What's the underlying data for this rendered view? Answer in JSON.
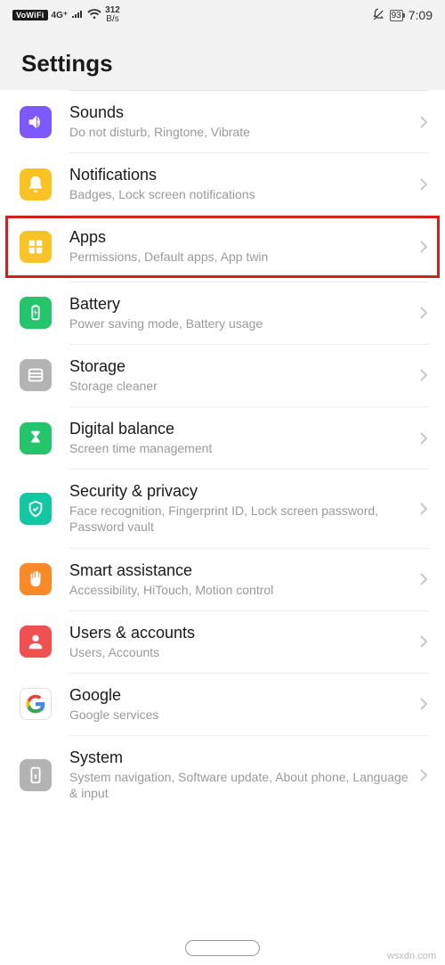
{
  "status": {
    "vowifi": "VoWiFi",
    "net_type": "4G⁺",
    "speed_num": "312",
    "speed_unit": "B/s",
    "battery": "93",
    "time": "7:09"
  },
  "header": {
    "title": "Settings"
  },
  "items": [
    {
      "title": "Sounds",
      "subtitle": "Do not disturb, Ringtone, Vibrate"
    },
    {
      "title": "Notifications",
      "subtitle": "Badges, Lock screen notifications"
    },
    {
      "title": "Apps",
      "subtitle": "Permissions, Default apps, App twin"
    },
    {
      "title": "Battery",
      "subtitle": "Power saving mode, Battery usage"
    },
    {
      "title": "Storage",
      "subtitle": "Storage cleaner"
    },
    {
      "title": "Digital balance",
      "subtitle": "Screen time management"
    },
    {
      "title": "Security & privacy",
      "subtitle": "Face recognition, Fingerprint ID, Lock screen password, Password vault"
    },
    {
      "title": "Smart assistance",
      "subtitle": "Accessibility, HiTouch, Motion control"
    },
    {
      "title": "Users & accounts",
      "subtitle": "Users, Accounts"
    },
    {
      "title": "Google",
      "subtitle": "Google services"
    },
    {
      "title": "System",
      "subtitle": "System navigation, Software update, About phone, Language & input"
    }
  ],
  "watermark": "wsxdn.com"
}
